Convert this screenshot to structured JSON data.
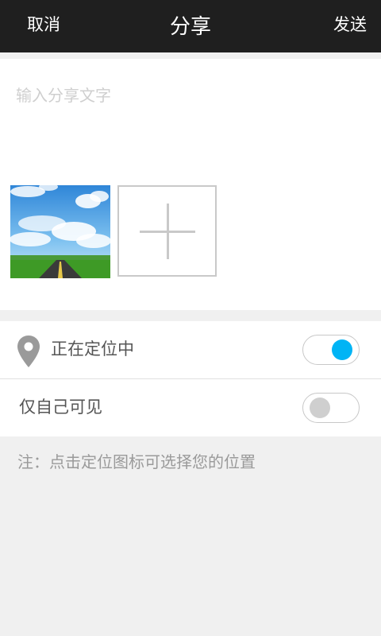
{
  "header": {
    "cancel_label": "取消",
    "title": "分享",
    "send_label": "发送"
  },
  "compose": {
    "text_value": "",
    "placeholder": "输入分享文字"
  },
  "settings": {
    "location_label": "正在定位中",
    "location_enabled": true,
    "private_label": "仅自己可见",
    "private_enabled": false
  },
  "note": "注：点击定位图标可选择您的位置",
  "colors": {
    "topbar_bg": "#1f1f1f",
    "toggle_on": "#00b4f5",
    "toggle_off": "#cfcfcf"
  },
  "icons": {
    "location": "location-pin-icon",
    "add": "plus-icon"
  }
}
